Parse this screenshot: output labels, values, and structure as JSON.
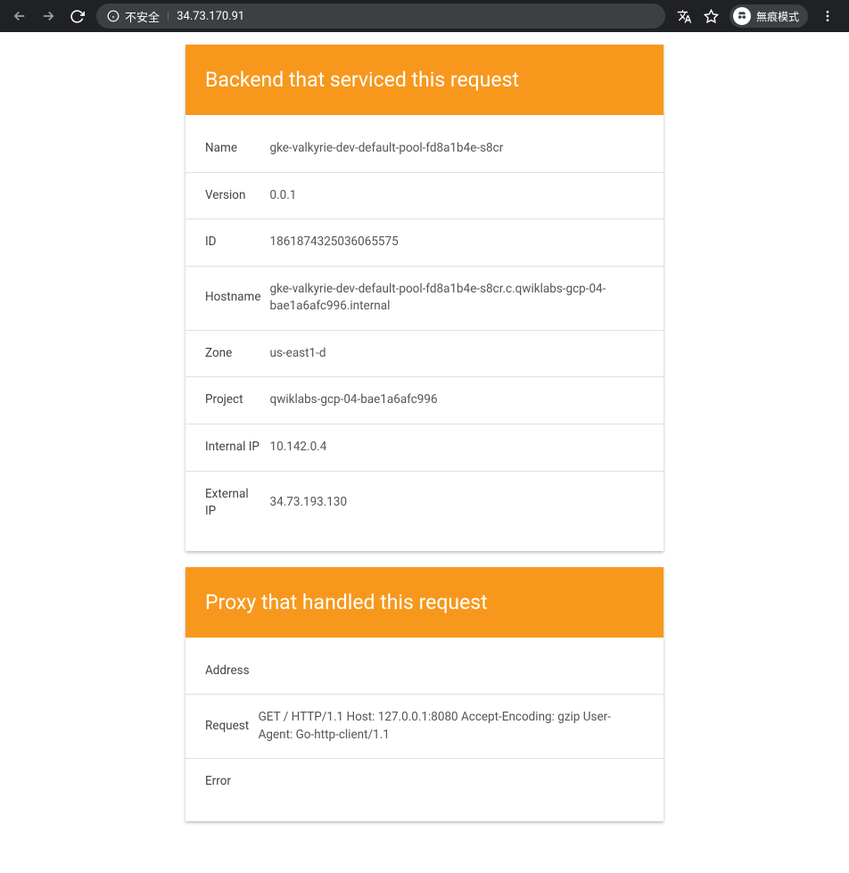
{
  "browser": {
    "security_text": "不安全",
    "url": "34.73.170.91",
    "incognito_label": "無痕模式"
  },
  "cards": {
    "backend": {
      "title": "Backend that serviced this request",
      "rows": [
        {
          "label": "Name",
          "value": "gke-valkyrie-dev-default-pool-fd8a1b4e-s8cr"
        },
        {
          "label": "Version",
          "value": "0.0.1"
        },
        {
          "label": "ID",
          "value": "1861874325036065575"
        },
        {
          "label": "Hostname",
          "value": "gke-valkyrie-dev-default-pool-fd8a1b4e-s8cr.c.qwiklabs-gcp-04-bae1a6afc996.internal"
        },
        {
          "label": "Zone",
          "value": "us-east1-d"
        },
        {
          "label": "Project",
          "value": "qwiklabs-gcp-04-bae1a6afc996"
        },
        {
          "label": "Internal IP",
          "value": "10.142.0.4"
        },
        {
          "label": "External IP",
          "value": "34.73.193.130"
        }
      ]
    },
    "proxy": {
      "title": "Proxy that handled this request",
      "rows": [
        {
          "label": "Address",
          "value": ""
        },
        {
          "label": "Request",
          "value": "GET / HTTP/1.1 Host: 127.0.0.1:8080 Accept-Encoding: gzip User-Agent: Go-http-client/1.1"
        },
        {
          "label": "Error",
          "value": ""
        }
      ]
    }
  }
}
